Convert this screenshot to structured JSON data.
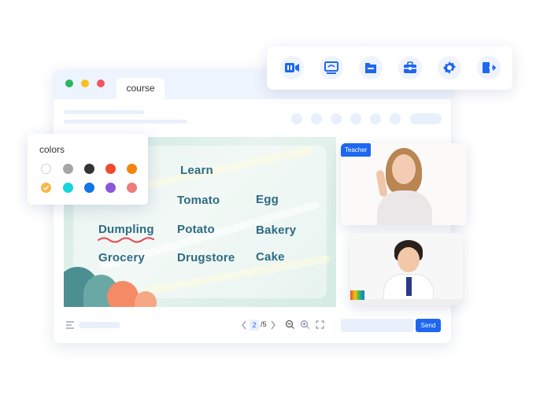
{
  "window": {
    "tab_label": "course"
  },
  "toolbar": {
    "icons": [
      "video-icon",
      "screen-share-icon",
      "folder-icon",
      "toolbox-icon",
      "settings-icon",
      "exit-icon"
    ],
    "accent": "#1e67f0"
  },
  "colors_panel": {
    "title": "colors",
    "swatches": [
      "#ffffff",
      "#a6a6a6",
      "#333333",
      "#f04a2c",
      "#f5840c",
      "#f8b74a",
      "#15d6dc",
      "#1275e8",
      "#8b57d9",
      "#f07b7b"
    ],
    "selected": "#f8b74a"
  },
  "slide": {
    "words": [
      "Learn",
      "Tomato",
      "Egg",
      "Dumpling",
      "Potato",
      "Bakery",
      "Grocery",
      "Drugstore",
      "Cake"
    ],
    "text_color": "#2e6b82",
    "underline_color": "#e8474f"
  },
  "pager": {
    "current": "2",
    "total": "/5"
  },
  "video": {
    "teacher_label": "Teacher"
  },
  "chat": {
    "send_label": "Send"
  }
}
